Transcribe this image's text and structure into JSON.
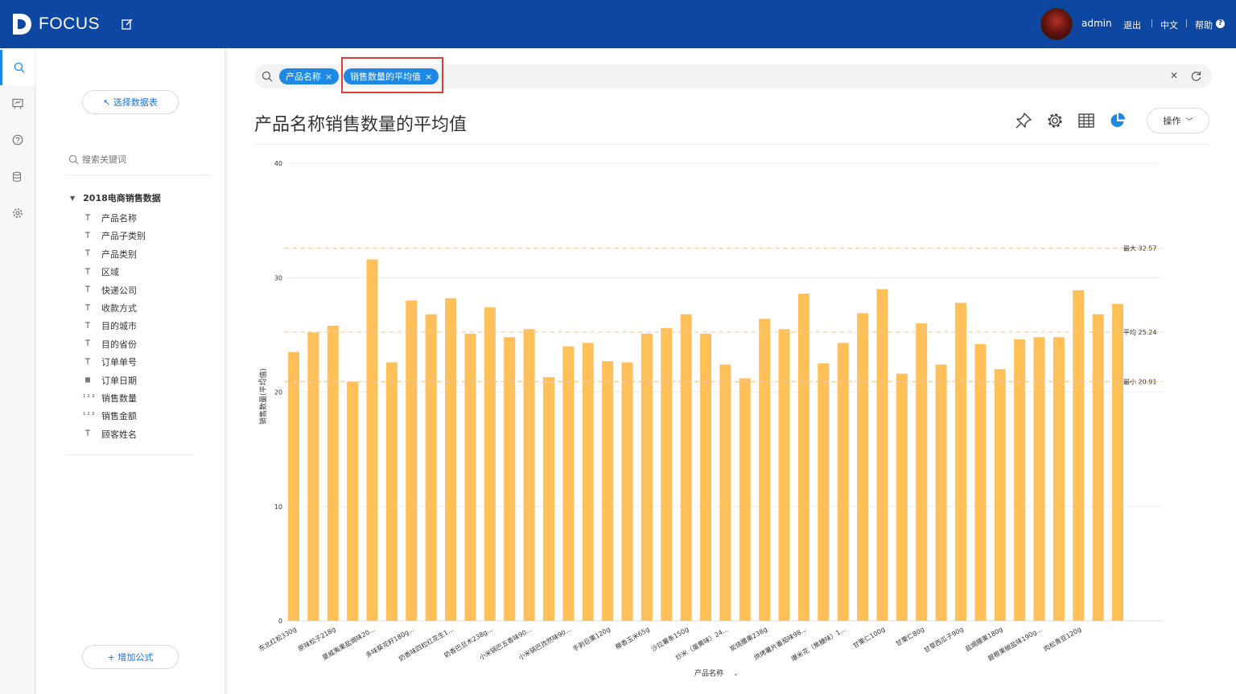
{
  "header": {
    "logo_text": "FOCUS",
    "user": "admin",
    "logout": "退出",
    "language": "中文",
    "help": "帮助",
    "help_badge": "?"
  },
  "sidebar": {
    "select_data_btn": "↖ 选择数据表",
    "search_placeholder": "搜索关键词",
    "dataset_name": "2018电商销售数据",
    "fields": [
      {
        "label": "产品名称",
        "icon": "T"
      },
      {
        "label": "产品子类别",
        "icon": "T"
      },
      {
        "label": "产品类别",
        "icon": "T"
      },
      {
        "label": "区域",
        "icon": "T"
      },
      {
        "label": "快递公司",
        "icon": "T"
      },
      {
        "label": "收款方式",
        "icon": "T"
      },
      {
        "label": "目的城市",
        "icon": "T"
      },
      {
        "label": "目的省份",
        "icon": "T"
      },
      {
        "label": "订单单号",
        "icon": "T"
      },
      {
        "label": "订单日期",
        "icon": "calendar"
      },
      {
        "label": "销售数量",
        "icon": "123"
      },
      {
        "label": "销售金额",
        "icon": "123"
      },
      {
        "label": "顾客姓名",
        "icon": "T"
      }
    ],
    "add_formula_btn": "+ 增加公式"
  },
  "query": {
    "chips": [
      "产品名称",
      "销售数量的平均值"
    ]
  },
  "main": {
    "title": "产品名称销售数量的平均值",
    "operate_btn": "操作"
  },
  "colors": {
    "brand": "#0d47a1",
    "accent": "#1e88e5",
    "bar": "#ffc05a",
    "refline": "#f5c99a",
    "highlight": "#e53935"
  },
  "chart_data": {
    "type": "bar",
    "xlabel": "产品名称",
    "ylabel": "销售数量(平均值)",
    "ylim": [
      0,
      40
    ],
    "yticks": [
      0,
      10,
      20,
      30,
      40
    ],
    "tick_labels": [
      "东北红松330g",
      "原味松子218g",
      "夏威夷果盐焗味20...",
      "多味葵花籽180g...",
      "奶香味四粒红花生1...",
      "奶香巴旦木238g...",
      "小米锅巴五香味90...",
      "小米锅巴孜然味90...",
      "手剥巨栗120g",
      "椰香玉米65g",
      "沙拉薯条150g",
      "炒米（蛋黄味）24...",
      "炭烧腰果238g",
      "烘烤薯片番茄味98...",
      "爆米花（焦糖味）1...",
      "甘栗仁100g",
      "甘栗仁80g",
      "甘草西瓜子90g",
      "盐焗腰果180g",
      "碧根果椒盐味190g...",
      "肉松青豆120g"
    ],
    "values": [
      23.5,
      25.2,
      25.8,
      20.9,
      31.6,
      22.6,
      28.0,
      26.8,
      28.2,
      25.1,
      27.4,
      24.8,
      25.5,
      21.3,
      24.0,
      24.3,
      22.7,
      22.6,
      25.1,
      25.6,
      26.8,
      25.1,
      22.4,
      21.2,
      26.4,
      25.5,
      28.6,
      22.5,
      24.3,
      26.9,
      29.0,
      21.6,
      26.0,
      22.4,
      27.8,
      24.2,
      22.0,
      24.6,
      24.8,
      24.8,
      28.9,
      26.8,
      27.7
    ],
    "ref_lines": [
      {
        "label": "最大 32.57",
        "value": 32.57
      },
      {
        "label": "平均 25.24",
        "value": 25.24
      },
      {
        "label": "最小 20.91",
        "value": 20.91
      }
    ],
    "grid": true
  }
}
